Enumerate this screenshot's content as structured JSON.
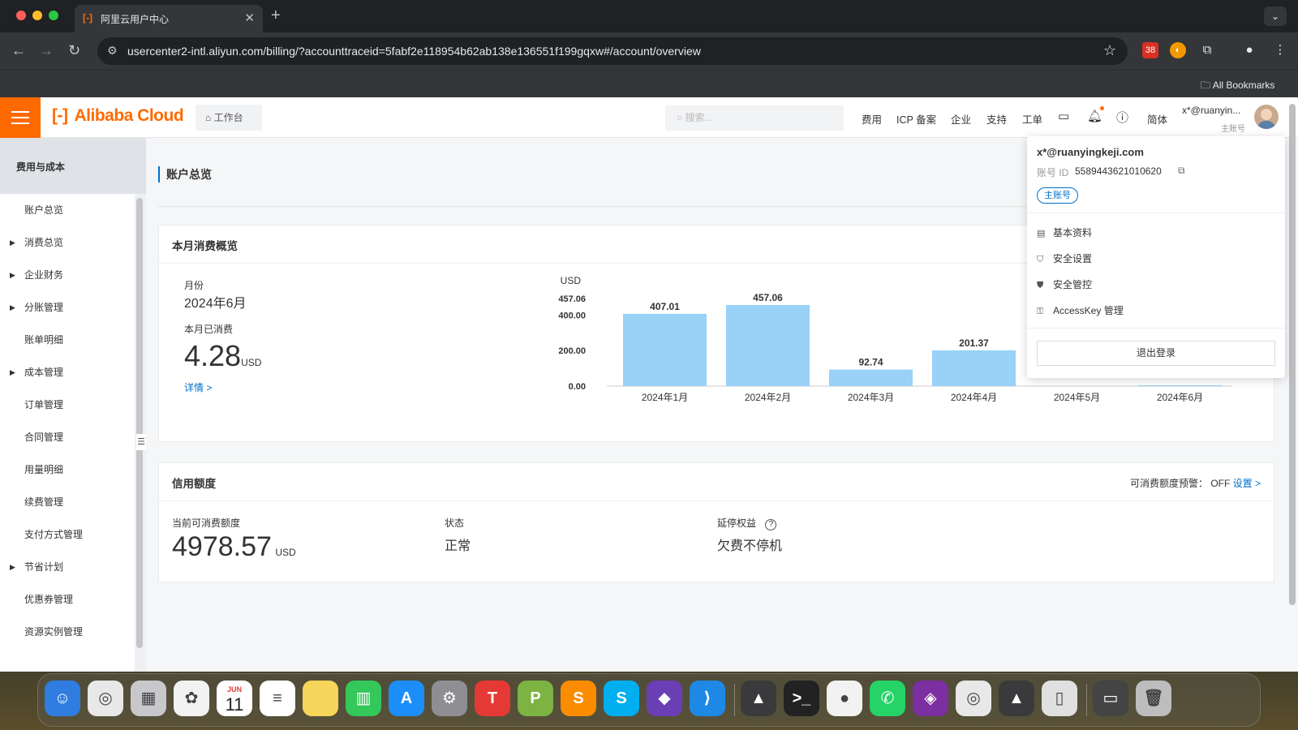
{
  "browser": {
    "tab_title": "阿里云用户中心",
    "tab_favicon": "[-]",
    "url": "usercenter2-intl.aliyun.com/billing/?accounttraceid=5fabf2e118954b62ab138e136551f199gqxw#/account/overview",
    "bookmarks_label": "All Bookmarks",
    "ext_badge": "38"
  },
  "header": {
    "logo": "Alibaba Cloud",
    "workbench": "工作台",
    "search_placeholder": "搜索...",
    "nav": [
      "费用",
      "ICP 备案",
      "企业",
      "支持",
      "工单"
    ],
    "lang": "简体",
    "user_short": "x*@ruanyin...",
    "user_role": "主账号"
  },
  "sidebar": {
    "title": "费用与成本",
    "items": [
      {
        "label": "账户总览",
        "expandable": false,
        "active": true
      },
      {
        "label": "消费总览",
        "expandable": true
      },
      {
        "label": "企业财务",
        "expandable": true
      },
      {
        "label": "分账管理",
        "expandable": true
      },
      {
        "label": "账单明细",
        "expandable": false
      },
      {
        "label": "成本管理",
        "expandable": true
      },
      {
        "label": "订单管理",
        "expandable": false
      },
      {
        "label": "合同管理",
        "expandable": false
      },
      {
        "label": "用量明细",
        "expandable": false
      },
      {
        "label": "续费管理",
        "expandable": false
      },
      {
        "label": "支付方式管理",
        "expandable": false
      },
      {
        "label": "节省计划",
        "expandable": true
      },
      {
        "label": "优惠券管理",
        "expandable": false
      },
      {
        "label": "资源实例管理",
        "expandable": false
      }
    ]
  },
  "main": {
    "breadcrumb": "账户总览",
    "monthly": {
      "title": "本月消费概览",
      "month_label": "月份",
      "month_value": "2024年6月",
      "spent_label": "本月已消费",
      "spent_value": "4.28",
      "spent_unit": "USD",
      "detail_link": "详情 >"
    },
    "credit": {
      "title": "信用额度",
      "alert_label": "可消费额度预警：",
      "alert_value": "OFF",
      "alert_link": "设置 >",
      "available_label": "当前可消费额度",
      "available_value": "4978.57",
      "available_unit": "USD",
      "status_label": "状态",
      "status_value": "正常",
      "benefit_label": "延停权益",
      "benefit_value": "欠费不停机"
    }
  },
  "chart_data": {
    "type": "bar",
    "ylabel": "USD",
    "categories": [
      "2024年1月",
      "2024年2月",
      "2024年3月",
      "2024年4月",
      "2024年5月",
      "2024年6月"
    ],
    "values": [
      407.01,
      457.06,
      92.74,
      201.37,
      null,
      4.28
    ],
    "value_labels": [
      "407.01",
      "457.06",
      "92.74",
      "201.37",
      "",
      ""
    ],
    "yticks": [
      "0.00",
      "200.00",
      "400.00",
      "457.06"
    ],
    "ylim": [
      0,
      457.06
    ],
    "color": "#99d1f7"
  },
  "account_dropdown": {
    "email": "x*@ruanyingkeji.com",
    "id_label": "账号 ID",
    "id_value": "5589443621010620",
    "role_pill": "主账号",
    "menu": [
      "基本资料",
      "安全设置",
      "安全管控",
      "AccessKey 管理"
    ],
    "logout": "退出登录"
  },
  "dock": {
    "apps": [
      "Finder",
      "Chrome",
      "Launchpad",
      "Photos",
      "Calendar",
      "Reminders",
      "Notes",
      "Numbers",
      "App Store",
      "System Settings",
      "T",
      "P",
      "S",
      "Skype",
      "Visual Studio",
      "VS Code",
      "Rocket",
      "Terminal",
      "MongoDB",
      "WhatsApp",
      "App",
      "Chrome",
      "Rocket",
      "Preview",
      "Folder",
      "Trash"
    ],
    "calendar_month": "JUN",
    "calendar_day": "11"
  }
}
